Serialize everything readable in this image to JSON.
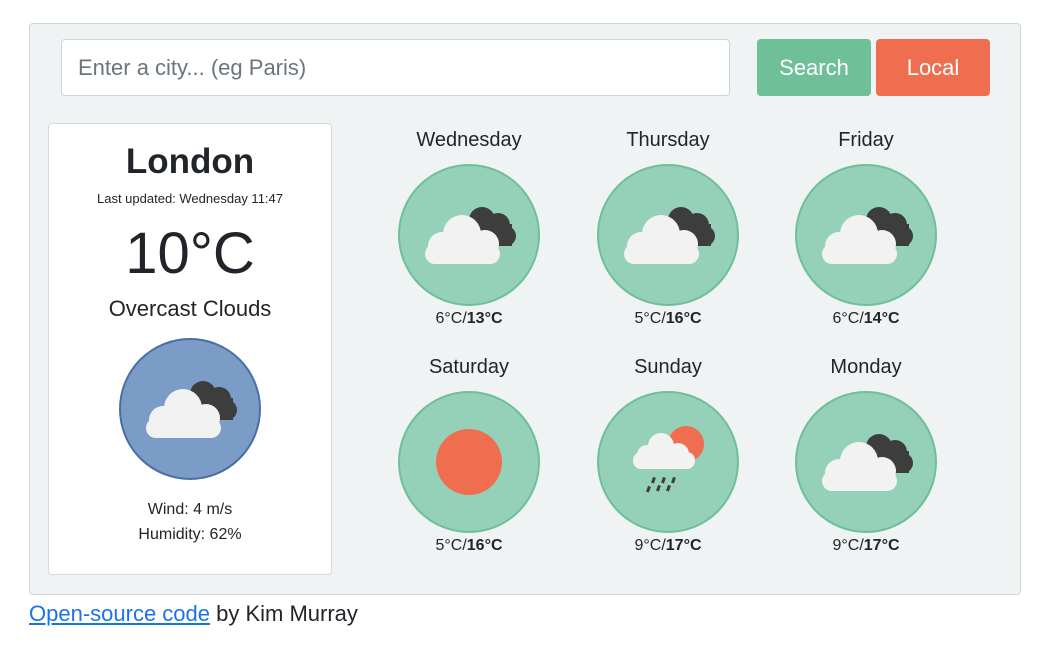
{
  "search": {
    "placeholder": "Enter a city... (eg Paris)",
    "value": ""
  },
  "buttons": {
    "search": "Search",
    "local": "Local"
  },
  "colors": {
    "search": "#6fbf99",
    "local": "#ef6e4f",
    "forecast_circle": "#94d1b8",
    "current_circle": "#7a9cc6"
  },
  "current": {
    "city": "London",
    "last_updated": "Last updated: Wednesday 11:47",
    "temperature": "10°C",
    "description": "Overcast Clouds",
    "icon": "overcast-clouds-icon",
    "wind": "Wind: 4 m/s",
    "humidity": "Humidity: 62%"
  },
  "forecast": [
    {
      "day": "Wednesday",
      "min": "6°C",
      "max": "13°C",
      "icon": "overcast-clouds-icon"
    },
    {
      "day": "Thursday",
      "min": "5°C",
      "max": "16°C",
      "icon": "overcast-clouds-icon"
    },
    {
      "day": "Friday",
      "min": "6°C",
      "max": "14°C",
      "icon": "overcast-clouds-icon"
    },
    {
      "day": "Saturday",
      "min": "5°C",
      "max": "16°C",
      "icon": "sun-icon"
    },
    {
      "day": "Sunday",
      "min": "9°C",
      "max": "17°C",
      "icon": "light-rain-icon"
    },
    {
      "day": "Monday",
      "min": "9°C",
      "max": "17°C",
      "icon": "overcast-clouds-icon"
    }
  ],
  "footer": {
    "link_text": "Open-source code",
    "by_text": " by Kim Murray"
  }
}
